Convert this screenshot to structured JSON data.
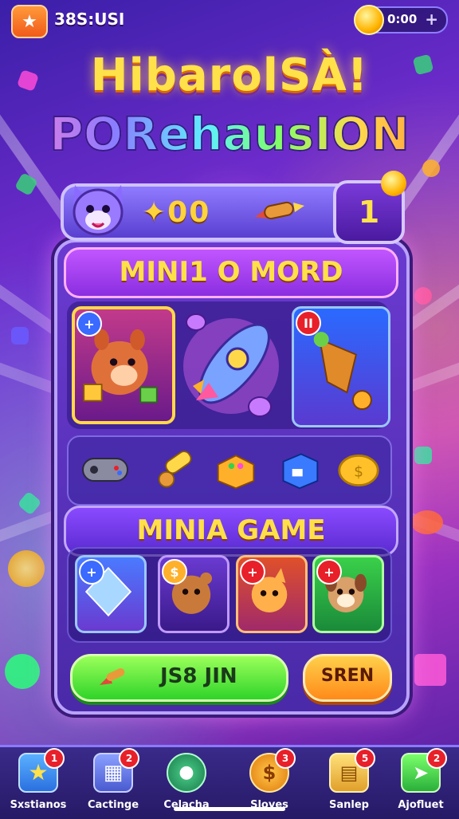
{
  "top_bar": {
    "back_icon": "back-arrow-icon",
    "score_text": "38S:USI",
    "coins_value": "0:00",
    "plus_label": "+"
  },
  "title": {
    "line1": "HibarolSÀ!",
    "line2": "PORehausION"
  },
  "header": {
    "score": "00",
    "level": "1"
  },
  "sections": {
    "section1_title": "MINI1 O MORD",
    "section2_title": "MINIA GAME"
  },
  "featured_cards": [
    {
      "name": "squirrel-card",
      "badge": "+"
    },
    {
      "name": "rocket-center",
      "badge": ""
    },
    {
      "name": "drill-rocket-card",
      "badge": "II"
    }
  ],
  "items": [
    {
      "name": "gamepad-icon"
    },
    {
      "name": "cannon-icon"
    },
    {
      "name": "dice-box-icon"
    },
    {
      "name": "blue-cube-icon"
    },
    {
      "name": "gold-coin-icon"
    }
  ],
  "games": [
    {
      "name": "crystal-game",
      "badge": "+"
    },
    {
      "name": "bear-game",
      "badge": "$"
    },
    {
      "name": "cat-game",
      "badge": "+"
    },
    {
      "name": "dog-game",
      "badge": "+"
    }
  ],
  "actions": {
    "play_label": "JS8 JIN",
    "secondary_label": "SREN"
  },
  "bottom_nav": [
    {
      "label": "Sxstianos",
      "badge": "1",
      "color": "#3aa0ff"
    },
    {
      "label": "Cactinge",
      "badge": "2",
      "color": "#5a7adf"
    },
    {
      "label": "Celacha",
      "badge": "",
      "color": "#2aa070"
    },
    {
      "label": "Sloves",
      "badge": "3",
      "color": "#ffae2a"
    },
    {
      "label": "Sanlep",
      "badge": "5",
      "color": "#ffc84a"
    },
    {
      "label": "Ajofluet",
      "badge": "2",
      "color": "#3ad04a"
    }
  ],
  "colors": {
    "accent_yellow": "#ffe14a",
    "panel_purple": "#6a3ad0",
    "play_green": "#2fd42a",
    "secondary_orange": "#ff8a1a"
  }
}
